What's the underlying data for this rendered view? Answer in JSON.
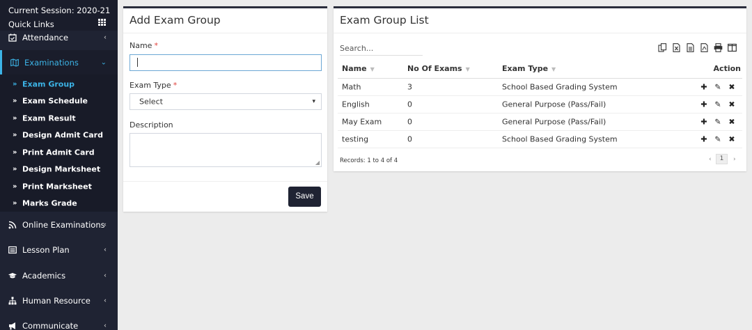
{
  "sidebar": {
    "session": "Current Session: 2020-21",
    "quick_links": "Quick Links",
    "items": [
      {
        "label": "Attendance"
      },
      {
        "label": "Examinations"
      },
      {
        "label": "Online Examinations"
      },
      {
        "label": "Lesson Plan"
      },
      {
        "label": "Academics"
      },
      {
        "label": "Human Resource"
      },
      {
        "label": "Communicate"
      }
    ],
    "submenu": [
      {
        "label": "Exam Group"
      },
      {
        "label": "Exam Schedule"
      },
      {
        "label": "Exam Result"
      },
      {
        "label": "Design Admit Card"
      },
      {
        "label": "Print Admit Card"
      },
      {
        "label": "Design Marksheet"
      },
      {
        "label": "Print Marksheet"
      },
      {
        "label": "Marks Grade"
      }
    ]
  },
  "form": {
    "title": "Add Exam Group",
    "name_label": "Name",
    "required": "*",
    "name_value": "",
    "exam_type_label": "Exam Type",
    "exam_type_value": "Select",
    "description_label": "Description",
    "description_value": "",
    "save_label": "Save"
  },
  "list": {
    "title": "Exam Group List",
    "search_placeholder": "Search...",
    "columns": {
      "name": "Name",
      "exams": "No Of Exams",
      "type": "Exam Type",
      "action": "Action"
    },
    "rows": [
      {
        "name": "Math",
        "exams": "3",
        "type": "School Based Grading System"
      },
      {
        "name": "English",
        "exams": "0",
        "type": "General Purpose (Pass/Fail)"
      },
      {
        "name": "May Exam",
        "exams": "0",
        "type": "General Purpose (Pass/Fail)"
      },
      {
        "name": "testing",
        "exams": "0",
        "type": "School Based Grading System"
      }
    ],
    "records": "Records: 1 to 4 of 4",
    "page": "1"
  },
  "colors": {
    "accent": "#3cb4e7",
    "sidebar": "#1f2333",
    "button": "#1f2333",
    "required": "#e0413b"
  }
}
